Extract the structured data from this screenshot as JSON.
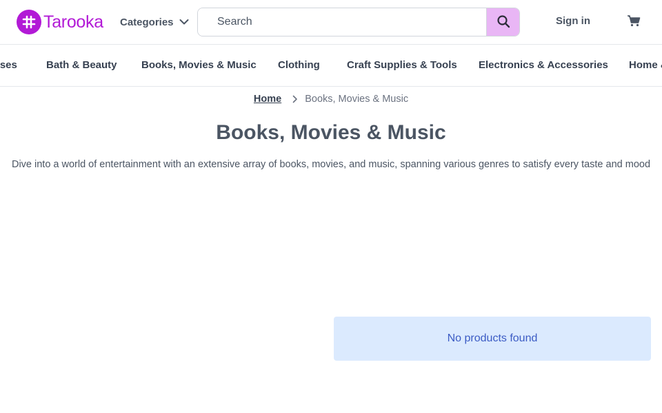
{
  "header": {
    "logo_text": "Tarooka",
    "categories_label": "Categories",
    "search_placeholder": "Search",
    "signin_label": "Sign in"
  },
  "category_nav": {
    "items": [
      "rses",
      "Bath & Beauty",
      "Books, Movies & Music",
      "Clothing",
      "Craft Supplies & Tools",
      "Electronics & Accessories",
      "Home &"
    ]
  },
  "breadcrumb": {
    "home": "Home",
    "current": "Books, Movies & Music"
  },
  "page": {
    "title": "Books, Movies & Music",
    "description": "Dive into a world of entertainment with an extensive array of books, movies, and music, spanning various genres to satisfy every taste and mood"
  },
  "results": {
    "empty_message": "No products found"
  },
  "colors": {
    "brand": "#b21ad6",
    "search_button": "#e9b6f5",
    "empty_bg": "#dbeafe",
    "empty_text": "#3b5bc4"
  },
  "icons": {
    "logo": "tarooka-logo-icon",
    "categories": "chevron-down-icon",
    "search": "search-icon",
    "cart": "cart-icon",
    "breadcrumb_sep": "chevron-right-icon"
  }
}
